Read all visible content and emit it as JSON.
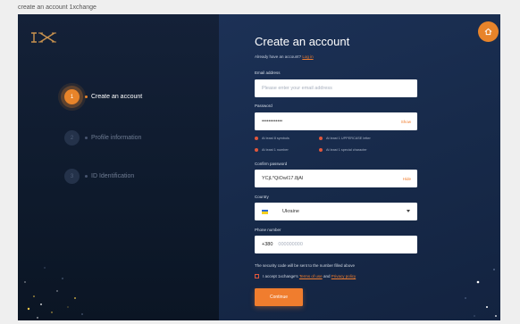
{
  "window": {
    "caption": "create an account 1xchange"
  },
  "steps": [
    {
      "number": "1",
      "label": "Create an account",
      "active": true
    },
    {
      "number": "2",
      "label": "Profile information",
      "active": false
    },
    {
      "number": "3",
      "label": "ID Identification",
      "active": false
    }
  ],
  "form": {
    "title": "Create an account",
    "signin_prompt": "Already have an account?",
    "signin_link": "Log in",
    "email": {
      "label": "Email address",
      "placeholder": "Please enter your email address"
    },
    "password": {
      "label": "Password",
      "value": "••••••••••••",
      "toggle": "Show"
    },
    "rules": [
      "At least 8 symbols",
      "At least 1 UPPERCASE letter",
      "At least 1 number",
      "At least 1 special character"
    ],
    "confirm": {
      "label": "Confirm password",
      "value": "YCjL*QiOwI17.8jAl",
      "toggle": "Hide"
    },
    "country": {
      "label": "Country",
      "value": "Ukraine"
    },
    "phone": {
      "label": "Phone number",
      "prefix": "+380",
      "placeholder": "000000000"
    },
    "security_note": "The security code will be sent to the number filled above",
    "terms": {
      "prefix": "I accept 1xchange's",
      "terms_link": "Terms of use",
      "and": "and",
      "privacy_link": "Privacy policy"
    },
    "submit": "Continue"
  },
  "colors": {
    "accent": "#f07d2e",
    "left_bg": "#142138",
    "right_bg": "#1c3156",
    "rule_dot": "#e0573c"
  },
  "icons": {
    "home": "home-icon",
    "logo": "1x-logo",
    "chevron": "chevron-down-icon",
    "flag": "ukraine-flag-icon"
  }
}
